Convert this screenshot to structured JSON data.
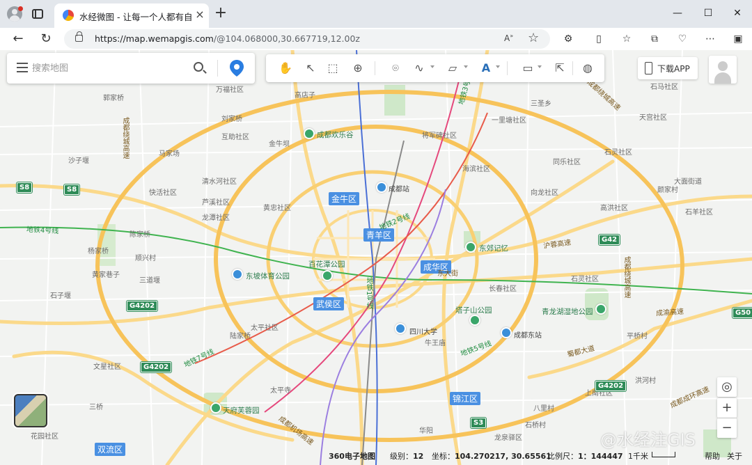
{
  "browser": {
    "tab_title": "水经微图 - 让每一个人都有自己的",
    "tab_close": "×",
    "new_tab": "+",
    "url_host": "https://map.wemapgis.com",
    "url_rest": "/@104.068000,30.667719,12.00z",
    "read_aloud": "A)",
    "window_minimize": "—",
    "window_maximize": "☐",
    "window_close": "✕"
  },
  "search": {
    "placeholder": "搜索地图"
  },
  "app_download": {
    "label": "下载APP"
  },
  "map": {
    "districts": [
      {
        "name": "金牛区"
      },
      {
        "name": "青羊区"
      },
      {
        "name": "成华区"
      },
      {
        "name": "武侯区"
      },
      {
        "name": "锦江区"
      },
      {
        "name": "双流区"
      }
    ],
    "pois": [
      {
        "name": "成都欢乐谷"
      },
      {
        "name": "成都站"
      },
      {
        "name": "东郊记忆"
      },
      {
        "name": "百花潭公园"
      },
      {
        "name": "东坡体育公园"
      },
      {
        "name": "塔子山公园"
      },
      {
        "name": "四川大学"
      },
      {
        "name": "成都东站"
      },
      {
        "name": "青龙湖湿地公园"
      },
      {
        "name": "天府芙蓉园"
      }
    ],
    "places": [
      "高店子",
      "万福社区",
      "郭家桥",
      "刘家桥",
      "互助社区",
      "金牛坝",
      "马家场",
      "沙子堰",
      "快活社区",
      "清水河社区",
      "黄忠社区",
      "芦溪社区",
      "龙潭社区",
      "杨家桥",
      "陈家桥",
      "顺兴村",
      "黄家巷子",
      "三道堰",
      "石子堰",
      "太平社区",
      "陆家桥",
      "文星社区",
      "太平寺",
      "三桥",
      "花园社区",
      "华阳",
      "将军碑社区",
      "一里塘社区",
      "海滨社区",
      "向龙社区",
      "高洪社区",
      "石灵社区",
      "长春社区",
      "石灵社区",
      "大面街道",
      "同乐社区",
      "石马社区",
      "天宫社区",
      "三圣乡",
      "颜家村",
      "石羊社区",
      "洪河村",
      "平桥村",
      "上南社区",
      "八里村",
      "龙泉驿区",
      "石桥村"
    ],
    "roads": [
      "成都绕城高速",
      "成都绕城高速",
      "成都绕城高速",
      "沪蓉高速",
      "地铁4号线",
      "地铁1号线",
      "地铁2号线",
      "地铁3号线",
      "地铁7号线",
      "成都机场高速",
      "成都成环高速",
      "蜀都大道",
      "东大街",
      "成渝高速",
      "牛王庙",
      "地铁5号线"
    ],
    "shields": [
      "S8",
      "S8",
      "G42",
      "G4202",
      "G4202",
      "G50",
      "G4202",
      "S3"
    ]
  },
  "status": {
    "source": "360电子地图",
    "level_label": "级别：",
    "level_value": "12",
    "coord_label": "坐标：",
    "coord_value": "104.270217, 30.65561",
    "scale_label": "比例尺：",
    "scale_value": "1：144447",
    "scale_km": "1千米",
    "help": "帮助",
    "about": "关于"
  },
  "watermark": "@水经注GIS",
  "colors": {
    "ring_road": "#f7c35a",
    "major_road": "#fbd98a",
    "district_tag": "#4a90e2",
    "highway_shield": "#2e8b57"
  }
}
